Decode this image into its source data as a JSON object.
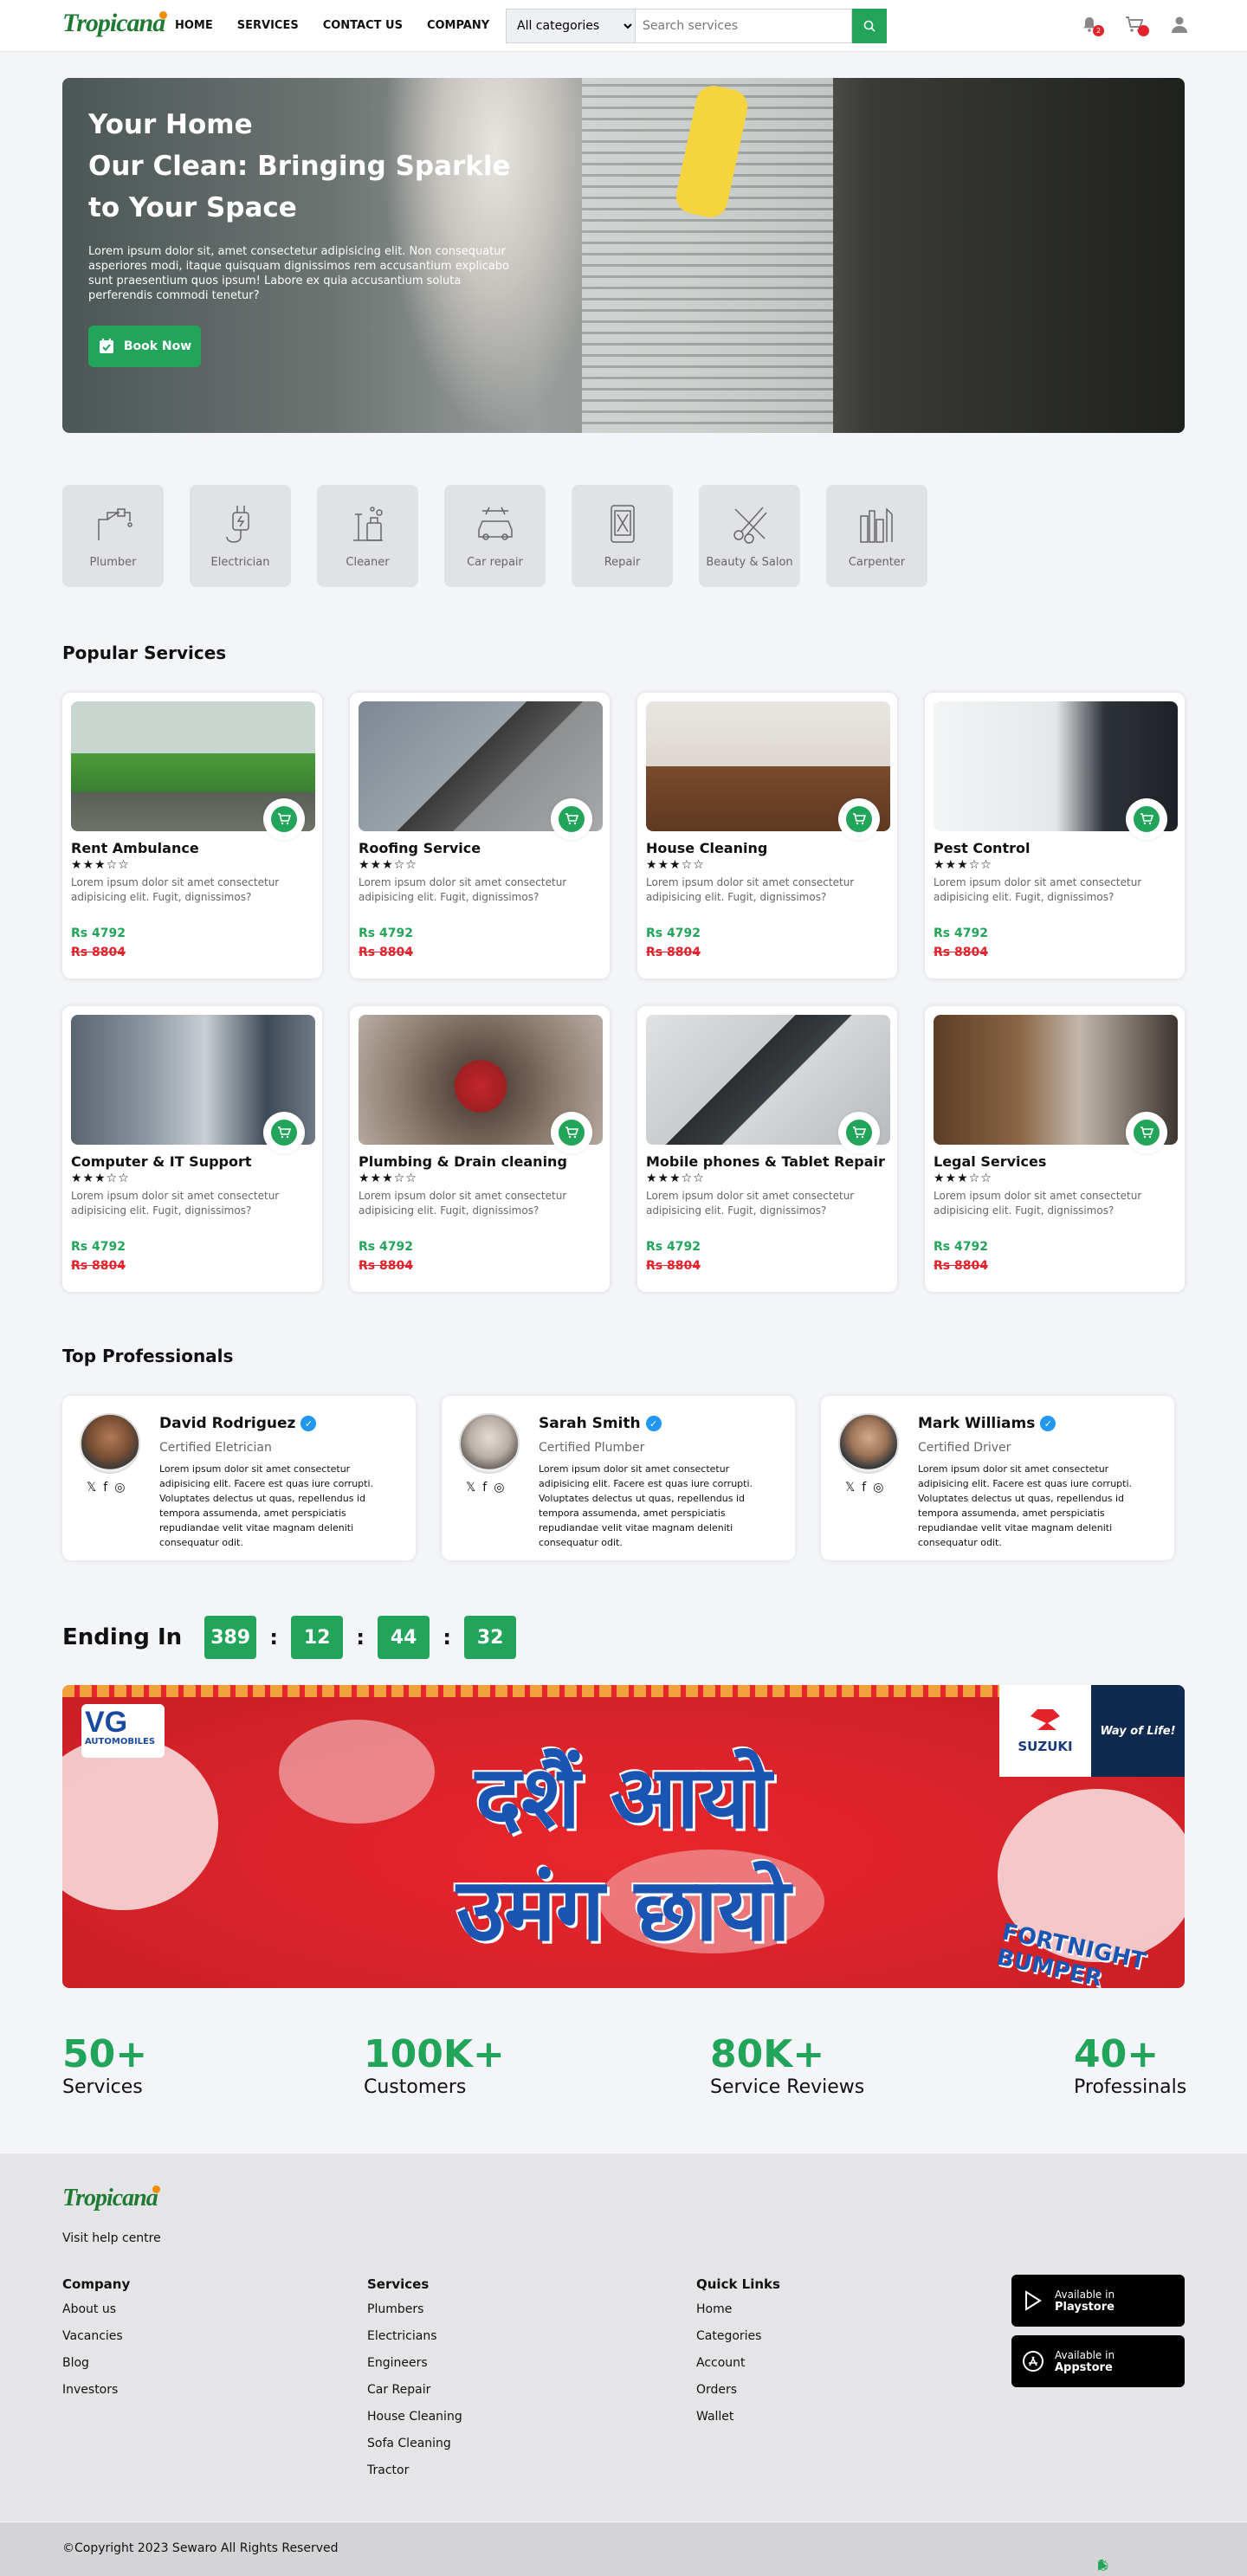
{
  "header": {
    "logo": "Tropicana",
    "nav": [
      "HOME",
      "SERVICES",
      "CONTACT US",
      "COMPANY"
    ],
    "category_select": "All categories",
    "search_placeholder": "Search services",
    "notification_count": "2",
    "accent_color": "#22a55a"
  },
  "hero": {
    "title_line1": "Your Home",
    "title_line2": "Our Clean: Bringing Sparkle",
    "title_line3": "to Your Space",
    "text": "Lorem ipsum dolor sit, amet consectetur adipisicing elit. Non consequatur asperiores modi, itaque quisquam dignissimos rem accusantium explicabo sunt praesentium quos ipsum! Labore ex quia accusantium soluta perferendis commodi tenetur?",
    "button": "Book Now"
  },
  "categories": [
    {
      "label": "Plumber",
      "icon": "plumber-icon"
    },
    {
      "label": "Electrician",
      "icon": "electrician-icon"
    },
    {
      "label": "Cleaner",
      "icon": "cleaner-icon"
    },
    {
      "label": "Car repair",
      "icon": "car-repair-icon"
    },
    {
      "label": "Repair",
      "icon": "repair-icon"
    },
    {
      "label": "Beauty & Salon",
      "icon": "beauty-salon-icon"
    },
    {
      "label": "Carpenter",
      "icon": "carpenter-icon"
    }
  ],
  "popular": {
    "title": "Popular Services",
    "cards": [
      {
        "title": "Rent Ambulance",
        "rating": 3,
        "desc": "Lorem ipsum dolor sit amet consectetur adipisicing elit. Fugit, dignissimos?",
        "price": "Rs 4792",
        "old_price": "Rs 8804"
      },
      {
        "title": "Roofing Service",
        "rating": 3,
        "desc": "Lorem ipsum dolor sit amet consectetur adipisicing elit. Fugit, dignissimos?",
        "price": "Rs 4792",
        "old_price": "Rs 8804"
      },
      {
        "title": "House Cleaning",
        "rating": 3,
        "desc": "Lorem ipsum dolor sit amet consectetur adipisicing elit. Fugit, dignissimos?",
        "price": "Rs 4792",
        "old_price": "Rs 8804"
      },
      {
        "title": "Pest Control",
        "rating": 3,
        "desc": "Lorem ipsum dolor sit amet consectetur adipisicing elit. Fugit, dignissimos?",
        "price": "Rs 4792",
        "old_price": "Rs 8804"
      },
      {
        "title": "Computer & IT Support",
        "rating": 3,
        "desc": "Lorem ipsum dolor sit amet consectetur adipisicing elit. Fugit, dignissimos?",
        "price": "Rs 4792",
        "old_price": "Rs 8804"
      },
      {
        "title": "Plumbing & Drain cleaning",
        "rating": 3,
        "desc": "Lorem ipsum dolor sit amet consectetur adipisicing elit. Fugit, dignissimos?",
        "price": "Rs 4792",
        "old_price": "Rs 8804"
      },
      {
        "title": "Mobile phones & Tablet Repair",
        "rating": 3,
        "desc": "Lorem ipsum dolor sit amet consectetur adipisicing elit. Fugit, dignissimos?",
        "price": "Rs 4792",
        "old_price": "Rs 8804"
      },
      {
        "title": "Legal Services",
        "rating": 3,
        "desc": "Lorem ipsum dolor sit amet consectetur adipisicing elit. Fugit, dignissimos?",
        "price": "Rs 4792",
        "old_price": "Rs 8804"
      }
    ]
  },
  "professionals": {
    "title": "Top Professionals",
    "items": [
      {
        "name": "David Rodriguez",
        "role": "Certified Eletrician",
        "desc": "Lorem ipsum dolor sit amet consectetur adipisicing elit. Facere est quas iure corrupti. Voluptates delectus ut quas, repellendus id tempora assumenda, amet perspiciatis repudiandae velit vitae magnam deleniti consequatur odit."
      },
      {
        "name": "Sarah Smith",
        "role": "Certified Plumber",
        "desc": "Lorem ipsum dolor sit amet consectetur adipisicing elit. Facere est quas iure corrupti. Voluptates delectus ut quas, repellendus id tempora assumenda, amet perspiciatis repudiandae velit vitae magnam deleniti consequatur odit."
      },
      {
        "name": "Mark Williams",
        "role": "Certified Driver",
        "desc": "Lorem ipsum dolor sit amet consectetur adipisicing elit. Facere est quas iure corrupti. Voluptates delectus ut quas, repellendus id tempora assumenda, amet perspiciatis repudiandae velit vitae magnam deleniti consequatur odit."
      }
    ]
  },
  "countdown": {
    "label": "Ending In",
    "days": "389",
    "hours": "12",
    "minutes": "44",
    "seconds": "32"
  },
  "banner": {
    "brand": "VG",
    "brand_sub": "AUTOMOBILES",
    "partner": "SUZUKI",
    "tagline": "Way of Life!",
    "line1": "दशैं आयो",
    "line2": "उमंग छायो",
    "ribbon": "FORTNIGHT BUMPER"
  },
  "stats": [
    {
      "value": "50+",
      "label": "Services"
    },
    {
      "value": "100K+",
      "label": "Customers"
    },
    {
      "value": "80K+",
      "label": "Service Reviews"
    },
    {
      "value": "40+",
      "label": "Professinals"
    }
  ],
  "footer": {
    "logo": "Tropicana",
    "help": "Visit help centre",
    "company": {
      "title": "Company",
      "links": [
        "About us",
        "Vacancies",
        "Blog",
        "Investors"
      ]
    },
    "services": {
      "title": "Services",
      "links": [
        "Plumbers",
        "Electricians",
        "Engineers",
        "Car Repair",
        "House Cleaning",
        "Sofa Cleaning",
        "Tractor"
      ]
    },
    "quick": {
      "title": "Quick Links",
      "links": [
        "Home",
        "Categories",
        "Account",
        "Orders",
        "Wallet"
      ]
    },
    "playstore": {
      "line1": "Available in",
      "line2": "Playstore"
    },
    "appstore": {
      "line1": "Available in",
      "line2": "Appstore"
    },
    "copyright": "©Copyright 2023 Sewaro All Rights Reserved"
  }
}
